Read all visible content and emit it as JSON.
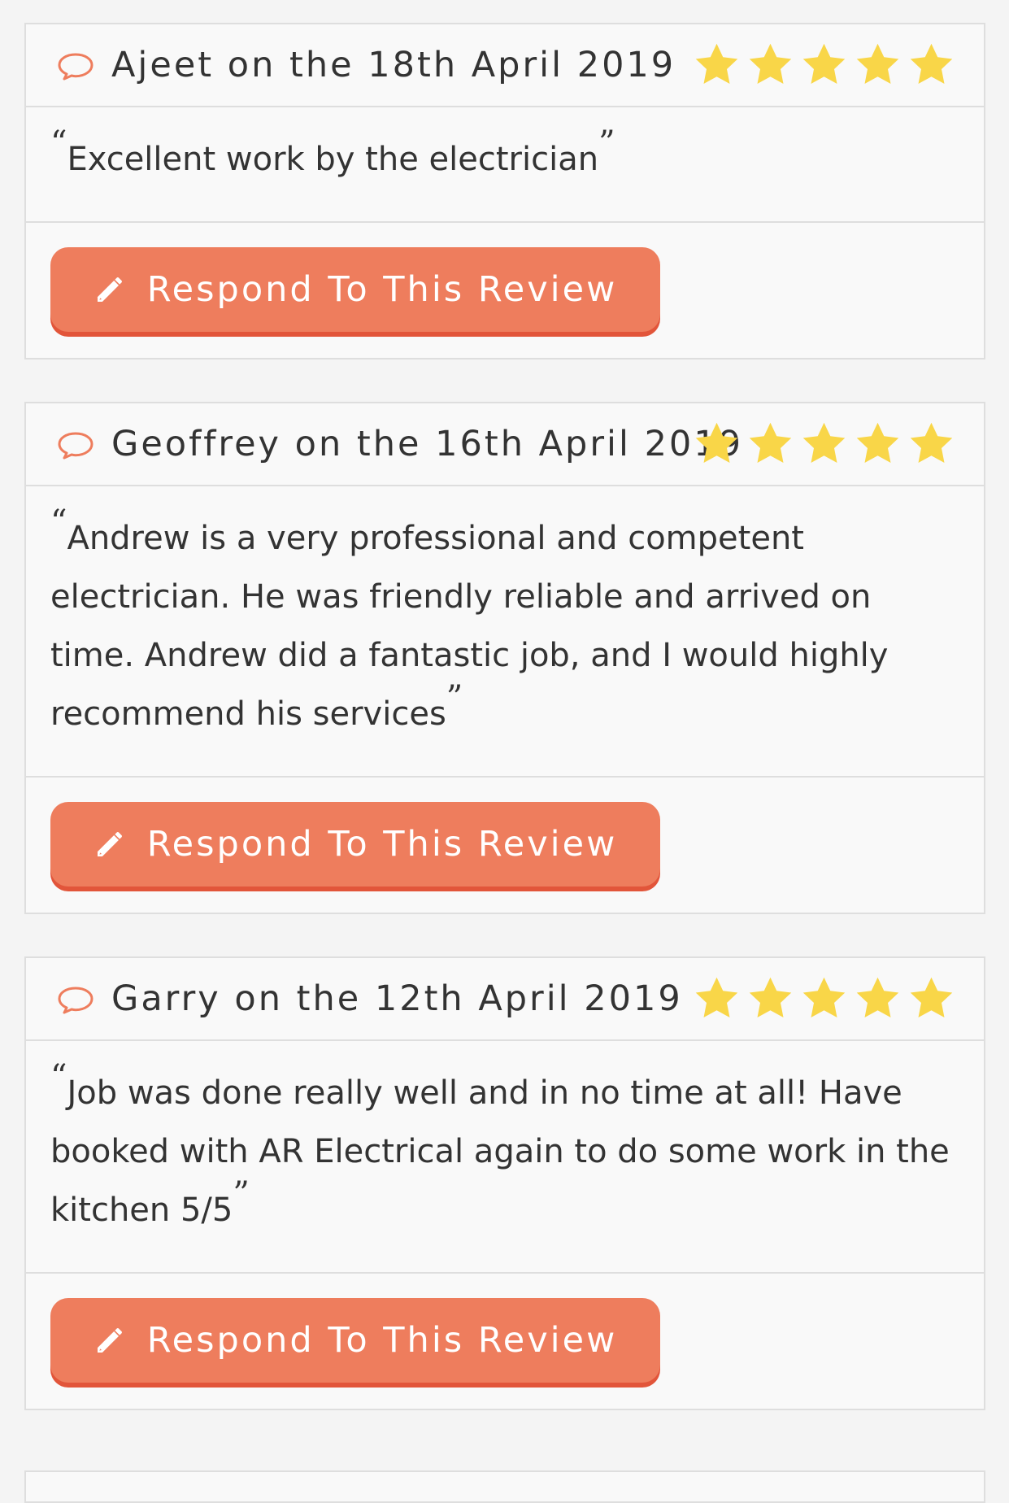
{
  "reviews": [
    {
      "author": "Ajeet",
      "title": "Ajeet on the 18th April 2019",
      "rating": 5,
      "text": "Excellent work by the electrician",
      "button_label": "Respond To This Review"
    },
    {
      "author": "Geoffrey",
      "title": "Geoffrey on the 16th April 2019",
      "rating": 5,
      "text": "Andrew is a very professional and competent electrician. He was friendly reliable and arrived on time. Andrew did a fantastic job, and I would highly recommend his services",
      "button_label": "Respond To This Review"
    },
    {
      "author": "Garry",
      "title": "Garry on the 12th April 2019",
      "rating": 5,
      "text": "Job was done really well and in no time at all! Have booked with AR Electrical again to do some work in the kitchen 5/5",
      "button_label": "Respond To This Review"
    }
  ],
  "colors": {
    "accent": "#ee7d5d",
    "accent_shadow": "#e2553a",
    "star": "#f9d648",
    "border": "#dedede",
    "card_bg": "#f9f9f9",
    "page_bg": "#f4f4f4"
  },
  "icons": {
    "header": "speech-bubble-icon",
    "rating": "star-icon",
    "button": "pencil-icon"
  }
}
